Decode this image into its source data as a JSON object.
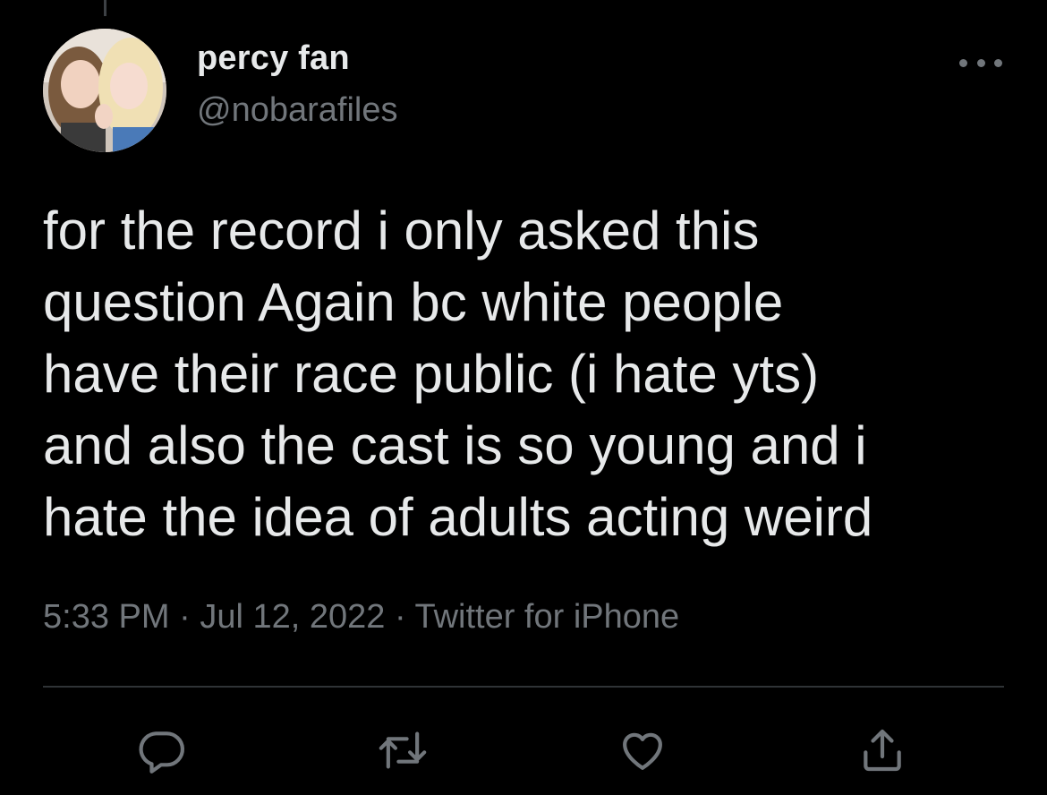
{
  "author": {
    "display_name": "percy fan",
    "handle": "@nobarafiles"
  },
  "tweet": {
    "lines": [
      "for the record i only asked this",
      "question Again bc white people",
      "have their race public (i hate yts)",
      "and also the cast is so young and i",
      "hate the idea of adults acting weird"
    ],
    "time": "5:33 PM",
    "date": "Jul 12, 2022",
    "source": "Twitter for iPhone",
    "separator": "·"
  },
  "icons": {
    "more": "more-horizontal-icon",
    "reply": "reply-icon",
    "retweet": "retweet-icon",
    "like": "heart-icon",
    "share": "share-icon"
  },
  "colors": {
    "background": "#000000",
    "primary_text": "#e7e9ea",
    "secondary_text": "#71767b",
    "divider": "#2f3336"
  }
}
